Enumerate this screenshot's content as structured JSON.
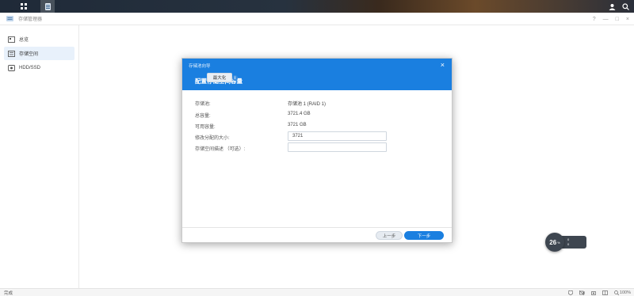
{
  "app": {
    "title": "存储管理器"
  },
  "sidebar": {
    "items": [
      {
        "label": "总览",
        "active": false
      },
      {
        "label": "存储空间",
        "active": true
      },
      {
        "label": "HDD/SSD",
        "active": false
      }
    ]
  },
  "window_controls": [
    "?",
    "—",
    "□",
    "×"
  ],
  "dialog": {
    "app_title": "存储池向导",
    "title": "配置存储空间容量",
    "fields": [
      {
        "label": "存储池:",
        "value": "存储池 1 (RAID 1)"
      },
      {
        "label": "总容量:",
        "value": "3721.4 GB"
      },
      {
        "label": "可用容量:",
        "value": "3721 GB"
      }
    ],
    "size_field": {
      "label": "修改分配的大小:",
      "value": "3721"
    },
    "desc_field": {
      "label": "存储空间描述 （可选）:",
      "value": ""
    },
    "max_button": "最大化",
    "info_icon": "i",
    "prev_button": "上一步",
    "next_button": "下一步"
  },
  "widget": {
    "value": "26",
    "unit": "%",
    "line1": "0",
    "line2": "0"
  },
  "statusbar": {
    "text": "完成",
    "zoom": "100%"
  },
  "colors": {
    "accent": "#1a7fe0",
    "header": "#1a7fe0"
  }
}
